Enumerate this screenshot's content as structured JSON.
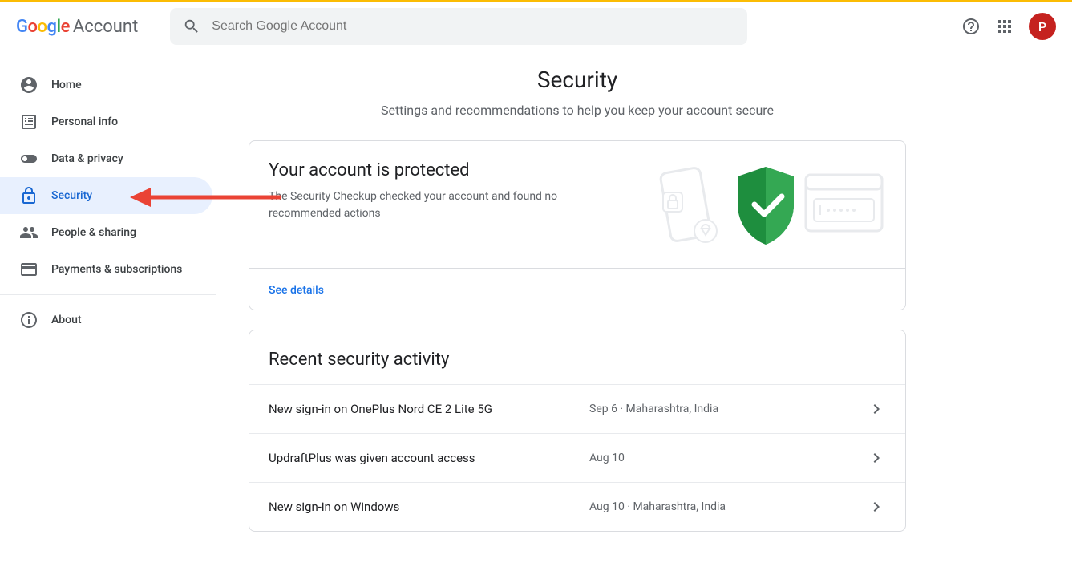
{
  "header": {
    "product": "Account",
    "search_placeholder": "Search Google Account",
    "avatar_initial": "P"
  },
  "sidebar": {
    "items": [
      {
        "label": "Home"
      },
      {
        "label": "Personal info"
      },
      {
        "label": "Data & privacy"
      },
      {
        "label": "Security"
      },
      {
        "label": "People & sharing"
      },
      {
        "label": "Payments & subscriptions"
      }
    ],
    "about": "About"
  },
  "page": {
    "title": "Security",
    "subtitle": "Settings and recommendations to help you keep your account secure"
  },
  "protection_card": {
    "title": "Your account is protected",
    "desc": "The Security Checkup checked your account and found no recommended actions",
    "link": "See details"
  },
  "activity_card": {
    "title": "Recent security activity",
    "rows": [
      {
        "text": "New sign-in on OnePlus Nord CE 2 Lite 5G",
        "meta": "Sep 6 · Maharashtra, India"
      },
      {
        "text": "UpdraftPlus was given account access",
        "meta": "Aug 10"
      },
      {
        "text": "New sign-in on Windows",
        "meta": "Aug 10 · Maharashtra, India"
      }
    ]
  }
}
